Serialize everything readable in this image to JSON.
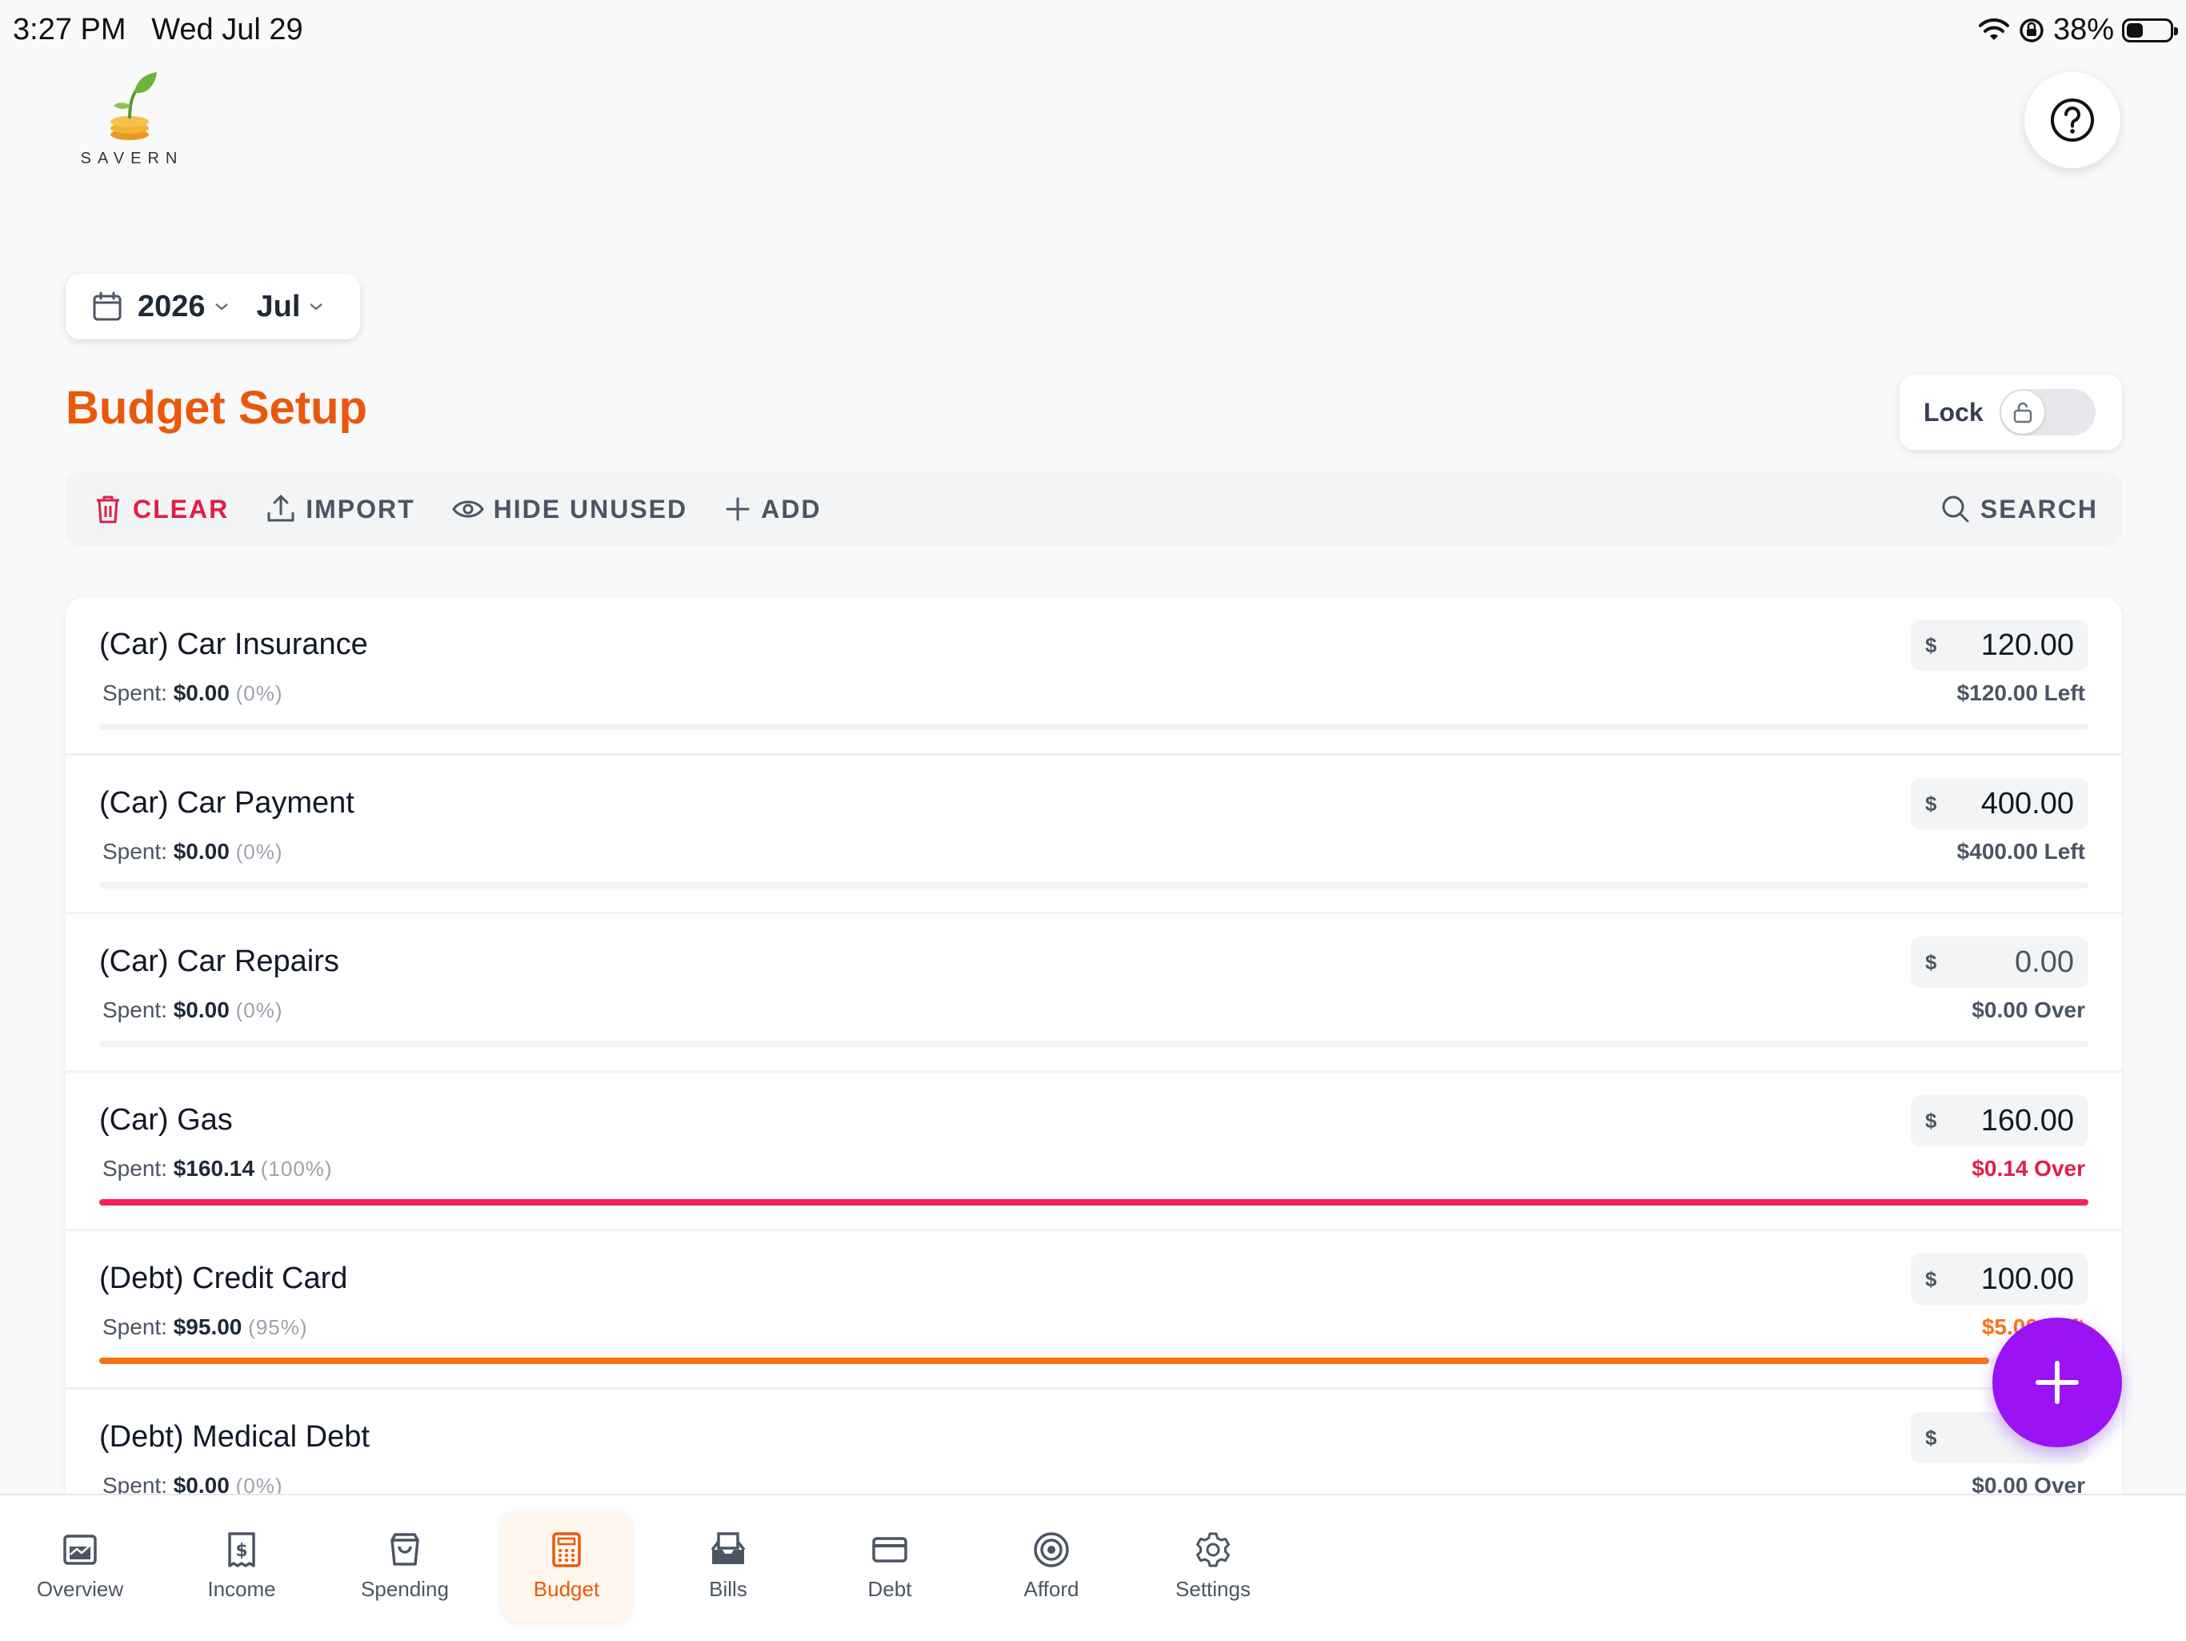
{
  "status_bar": {
    "time": "3:27 PM",
    "date": "Wed Jul 29",
    "battery": "38%",
    "battery_level": 0.38
  },
  "logo": {
    "text": "SAVERN"
  },
  "date_picker": {
    "year": "2026",
    "month": "Jul"
  },
  "page": {
    "title": "Budget Setup"
  },
  "lock": {
    "label": "Lock",
    "on": false
  },
  "toolbar": {
    "clear": "CLEAR",
    "import": "IMPORT",
    "hide_unused": "HIDE UNUSED",
    "add": "ADD",
    "search": "SEARCH"
  },
  "budget_rows": [
    {
      "name": "(Car) Car Insurance",
      "spent_label": "Spent:",
      "spent": "$0.00",
      "pct": "(0%)",
      "currency": "$",
      "amount": "120.00",
      "remaining": "$120.00 Left",
      "status": "left",
      "progress": 0
    },
    {
      "name": "(Car) Car Payment",
      "spent_label": "Spent:",
      "spent": "$0.00",
      "pct": "(0%)",
      "currency": "$",
      "amount": "400.00",
      "remaining": "$400.00 Left",
      "status": "left",
      "progress": 0
    },
    {
      "name": "(Car) Car Repairs",
      "spent_label": "Spent:",
      "spent": "$0.00",
      "pct": "(0%)",
      "currency": "$",
      "amount": "0.00",
      "remaining": "$0.00 Over",
      "status": "zero",
      "progress": 0
    },
    {
      "name": "(Car) Gas",
      "spent_label": "Spent:",
      "spent": "$160.14",
      "pct": "(100%)",
      "currency": "$",
      "amount": "160.00",
      "remaining": "$0.14 Over",
      "status": "over",
      "progress": 1.0
    },
    {
      "name": "(Debt) Credit Card",
      "spent_label": "Spent:",
      "spent": "$95.00",
      "pct": "(95%)",
      "currency": "$",
      "amount": "100.00",
      "remaining": "$5.00 Left",
      "status": "warn",
      "progress": 0.95
    },
    {
      "name": "(Debt) Medical Debt",
      "spent_label": "Spent:",
      "spent": "$0.00",
      "pct": "(0%)",
      "currency": "$",
      "amount": "",
      "remaining": "$0.00 Over",
      "status": "zero",
      "progress": 0
    }
  ],
  "colors": {
    "over": "#f0245a",
    "warn": "#f97316",
    "accent": "#ea580c",
    "fab": "#9b12f5"
  },
  "tabs": [
    {
      "label": "Overview",
      "icon": "chart-icon"
    },
    {
      "label": "Income",
      "icon": "dollar-receipt-icon"
    },
    {
      "label": "Spending",
      "icon": "shopping-bag-icon"
    },
    {
      "label": "Budget",
      "icon": "calculator-icon",
      "active": true
    },
    {
      "label": "Bills",
      "icon": "inbox-icon"
    },
    {
      "label": "Debt",
      "icon": "credit-card-icon"
    },
    {
      "label": "Afford",
      "icon": "target-icon"
    },
    {
      "label": "Settings",
      "icon": "gear-icon"
    }
  ]
}
